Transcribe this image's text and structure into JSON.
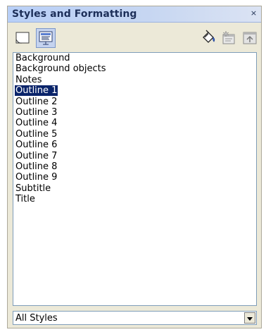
{
  "window": {
    "title": "Styles and Formatting",
    "close_glyph": "×"
  },
  "toolbar": {
    "left_buttons": [
      {
        "icon": "graphics-styles-icon",
        "active": false
      },
      {
        "icon": "presentation-styles-icon",
        "active": true
      }
    ],
    "right_buttons": [
      {
        "icon": "fill-format-mode-icon"
      },
      {
        "icon": "new-style-from-selection-icon"
      },
      {
        "icon": "update-style-icon"
      }
    ]
  },
  "style_list": {
    "items": [
      "Background",
      "Background objects",
      "Notes",
      "Outline 1",
      "Outline 2",
      "Outline 3",
      "Outline 4",
      "Outline 5",
      "Outline 6",
      "Outline 7",
      "Outline 8",
      "Outline 9",
      "Subtitle",
      "Title"
    ],
    "selected": "Outline 1"
  },
  "filter": {
    "selected_value": "All Styles"
  },
  "colors": {
    "selection_bg": "#0a246a",
    "panel_bg": "#ece9d8",
    "titlebar_text": "#1d2f59"
  }
}
